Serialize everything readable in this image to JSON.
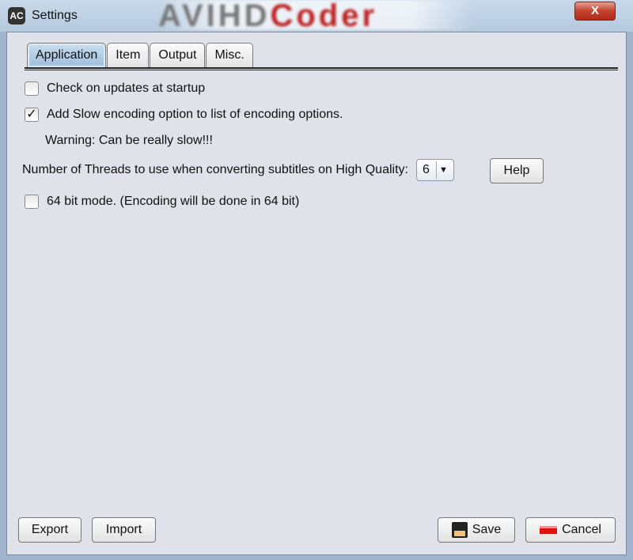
{
  "window": {
    "title": "Settings",
    "app_icon": "AC",
    "banner_a": "AVIHD",
    "banner_b": "Coder",
    "close_label": "X"
  },
  "tabs": [
    {
      "label": "Application",
      "active": true
    },
    {
      "label": "Item"
    },
    {
      "label": "Output"
    },
    {
      "label": "Misc."
    }
  ],
  "application": {
    "check_updates": {
      "label": "Check on updates at startup",
      "checked": false
    },
    "slow_encoding": {
      "label": "Add Slow encoding option to list of encoding options.",
      "checked": true
    },
    "warning": "Warning: Can be really slow!!!",
    "threads_label": "Number of Threads to use when converting subtitles on High Quality:",
    "threads_value": "6",
    "help_label": "Help",
    "bit64": {
      "label": "64 bit mode. (Encoding will be done in 64 bit)",
      "checked": false
    }
  },
  "footer": {
    "export": "Export",
    "import": "Import",
    "save": "Save",
    "cancel": "Cancel"
  },
  "check_mark": "✓",
  "combo_arrow": "▼"
}
